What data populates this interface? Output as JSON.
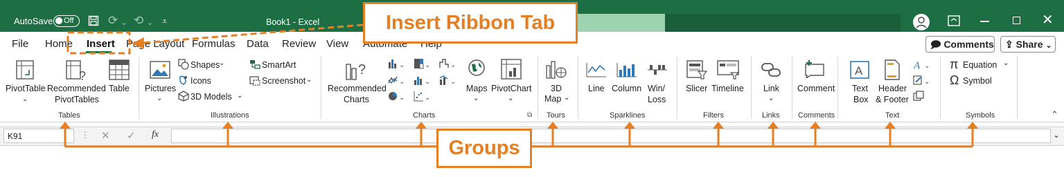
{
  "titlebar": {
    "autosave_label": "AutoSave",
    "autosave_state": "Off",
    "doc_title": "Book1  -  Excel",
    "icons": [
      "save-icon",
      "redo-icon",
      "undo-icon",
      "customize-icon",
      "account-icon",
      "ribbon-display-icon",
      "minimize-icon",
      "restore-icon",
      "close-icon"
    ]
  },
  "tabs": [
    "File",
    "Home",
    "Insert",
    "Page Layout",
    "Formulas",
    "Data",
    "Review",
    "View",
    "Automate",
    "Help"
  ],
  "active_tab": "Insert",
  "top_buttons": {
    "comments": "Comments",
    "share": "Share"
  },
  "ribbon": {
    "tables": {
      "pivot": "PivotTable",
      "rec_pivot_1": "Recommended",
      "rec_pivot_2": "PivotTables",
      "table": "Table",
      "group": "Tables"
    },
    "illustrations": {
      "pictures": "Pictures",
      "shapes": "Shapes",
      "icons": "Icons",
      "models": "3D Models",
      "smartart": "SmartArt",
      "screenshot": "Screenshot",
      "group": "Illustrations"
    },
    "charts": {
      "rec_1": "Recommended",
      "rec_2": "Charts",
      "maps": "Maps",
      "pivotchart": "PivotChart",
      "group": "Charts"
    },
    "tours": {
      "map_1": "3D",
      "map_2": "Map",
      "group": "Tours"
    },
    "sparklines": {
      "line": "Line",
      "column": "Column",
      "winloss_1": "Win/",
      "winloss_2": "Loss",
      "group": "Sparklines"
    },
    "filters": {
      "slicer": "Slicer",
      "timeline": "Timeline",
      "group": "Filters"
    },
    "links": {
      "link": "Link",
      "group": "Links"
    },
    "comments": {
      "comment": "Comment",
      "group": "Comments"
    },
    "text": {
      "textbox_1": "Text",
      "textbox_2": "Box",
      "header_1": "Header",
      "header_2": "& Footer",
      "group": "Text"
    },
    "symbols": {
      "equation": "Equation",
      "symbol": "Symbol",
      "group": "Symbols"
    }
  },
  "formula_bar": {
    "name_box": "K91",
    "fx": "fx"
  },
  "annotations": {
    "insert_tab": "Insert Ribbon Tab",
    "groups": "Groups"
  },
  "colors": {
    "title_green": "#1e6e43",
    "annotation_orange": "#e67e22"
  }
}
